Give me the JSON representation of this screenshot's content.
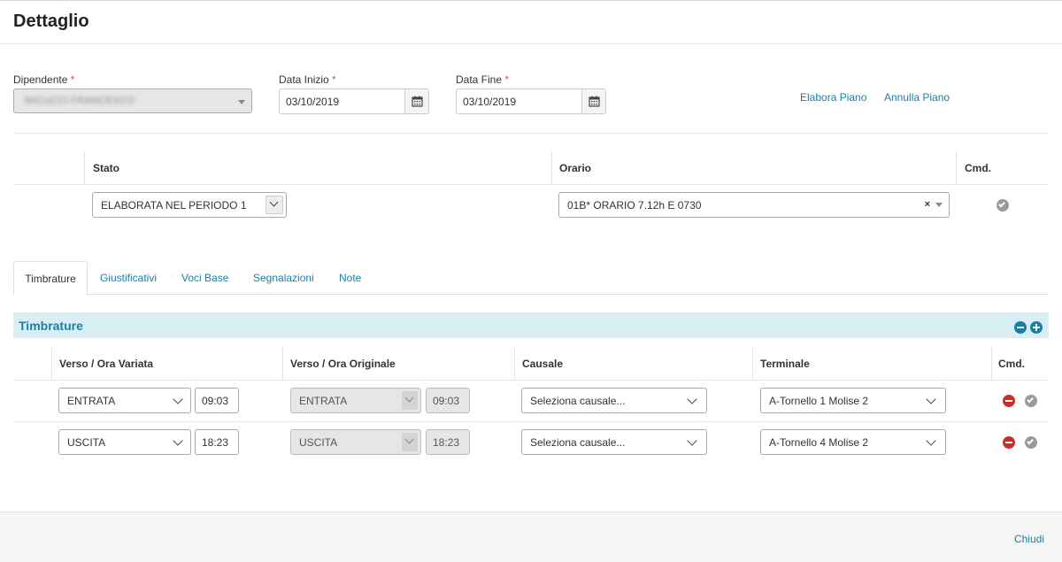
{
  "header": {
    "title": "Dettaglio"
  },
  "filters": {
    "dipendente_label": "Dipendente",
    "dipendente_value": "MICUCCI FRANCESCO",
    "data_inizio_label": "Data Inizio",
    "data_inizio_value": "03/10/2019",
    "data_fine_label": "Data Fine",
    "data_fine_value": "03/10/2019",
    "required_mark": "*",
    "elabora_link": "Elabora Piano",
    "annulla_link": "Annulla Piano"
  },
  "plan_table": {
    "col_stato": "Stato",
    "col_orario": "Orario",
    "col_cmd": "Cmd.",
    "stato_value": "ELABORATA NEL PERIODO 1",
    "orario_value": "01B* ORARIO 7.12h E 0730",
    "clear_mark": "×"
  },
  "tabs": [
    {
      "label": "Timbrature"
    },
    {
      "label": "Giustificativi"
    },
    {
      "label": "Voci Base"
    },
    {
      "label": "Segnalazioni"
    },
    {
      "label": "Note"
    }
  ],
  "timbrature": {
    "section_title": "Timbrature",
    "col_variata": "Verso / Ora Variata",
    "col_originale": "Verso / Ora Originale",
    "col_causale": "Causale",
    "col_terminale": "Terminale",
    "col_cmd": "Cmd.",
    "rows": [
      {
        "verso": "ENTRATA",
        "ora": "09:03",
        "verso_orig": "ENTRATA",
        "ora_orig": "09:03",
        "causale": "Seleziona causale...",
        "terminale": "A-Tornello 1 Molise 2"
      },
      {
        "verso": "USCITA",
        "ora": "18:23",
        "verso_orig": "USCITA",
        "ora_orig": "18:23",
        "causale": "Seleziona causale...",
        "terminale": "A-Tornello 4 Molise 2"
      }
    ]
  },
  "footer": {
    "close_label": "Chiudi"
  }
}
